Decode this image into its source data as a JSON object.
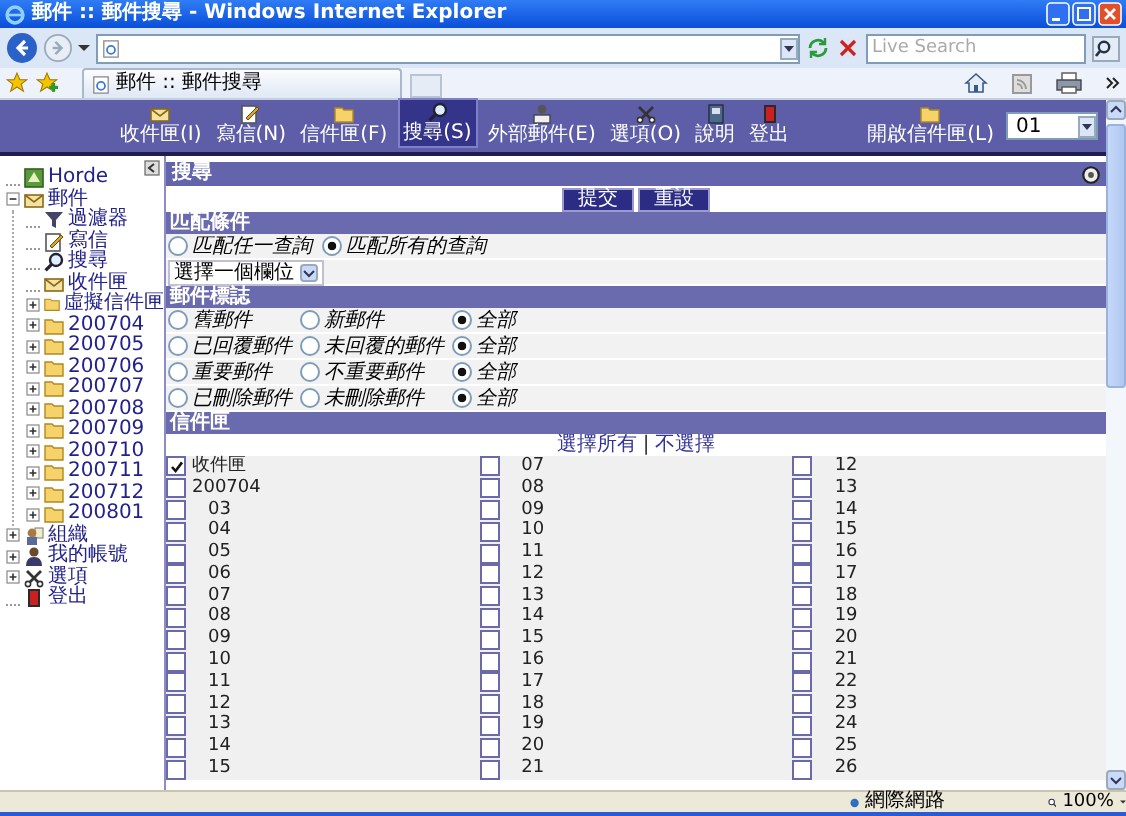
{
  "window": {
    "title": "郵件 :: 郵件搜尋 - Windows Internet Explorer"
  },
  "search": {
    "placeholder": "Live Search"
  },
  "tabs": [
    {
      "label": "郵件 :: 郵件搜尋",
      "selected": true
    }
  ],
  "nav": {
    "items": [
      {
        "label": "收件匣(I)",
        "kind": "inbox",
        "selected": false
      },
      {
        "label": "寫信(N)",
        "kind": "compose",
        "selected": false
      },
      {
        "label": "信件匣(F)",
        "kind": "folder",
        "selected": false
      },
      {
        "label": "搜尋(S)",
        "kind": "search",
        "selected": true
      },
      {
        "label": "外部郵件(E)",
        "kind": "external",
        "selected": false
      },
      {
        "label": "選項(O)",
        "kind": "options",
        "selected": false
      },
      {
        "label": "說明",
        "kind": "help",
        "selected": false
      },
      {
        "label": "登出",
        "kind": "logout",
        "selected": false
      }
    ],
    "open_folder": {
      "label": "開啟信件匣(L)",
      "value": "01"
    }
  },
  "sidebar": {
    "items": [
      {
        "label": "Horde",
        "kind": "app"
      },
      {
        "label": "郵件",
        "kind": "mail",
        "expanded": true,
        "children": [
          {
            "label": "過濾器",
            "kind": "filter"
          },
          {
            "label": "寫信",
            "kind": "compose"
          },
          {
            "label": "搜尋",
            "kind": "search"
          },
          {
            "label": "收件匣",
            "kind": "inbox"
          },
          {
            "label": "虛擬信件匣",
            "kind": "folder",
            "expanded": false
          },
          {
            "label": "200704",
            "kind": "folder",
            "expanded": false
          },
          {
            "label": "200705",
            "kind": "folder",
            "expanded": false
          },
          {
            "label": "200706",
            "kind": "folder",
            "expanded": false
          },
          {
            "label": "200707",
            "kind": "folder",
            "expanded": false
          },
          {
            "label": "200708",
            "kind": "folder",
            "expanded": false
          },
          {
            "label": "200709",
            "kind": "folder",
            "expanded": false
          },
          {
            "label": "200710",
            "kind": "folder",
            "expanded": false
          },
          {
            "label": "200711",
            "kind": "folder",
            "expanded": false
          },
          {
            "label": "200712",
            "kind": "folder",
            "expanded": false
          },
          {
            "label": "200801",
            "kind": "folder",
            "expanded": false
          }
        ]
      },
      {
        "label": "組織",
        "kind": "organizer",
        "expanded": false
      },
      {
        "label": "我的帳號",
        "kind": "account",
        "expanded": false
      },
      {
        "label": "選項",
        "kind": "options",
        "expanded": false
      },
      {
        "label": "登出",
        "kind": "logout"
      }
    ]
  },
  "panel": {
    "title": "搜尋",
    "buttons": [
      "提交",
      "重設"
    ]
  },
  "match": {
    "title": "匹配條件",
    "options": [
      {
        "label": "匹配任一查詢",
        "selected": false
      },
      {
        "label": "匹配所有的查詢",
        "selected": true
      }
    ],
    "field_select": "選擇一個欄位"
  },
  "flags": {
    "title": "郵件標誌",
    "rows": [
      {
        "options": [
          {
            "label": "舊郵件",
            "selected": false
          },
          {
            "label": "新郵件",
            "selected": false
          },
          {
            "label": "全部",
            "selected": true
          }
        ]
      },
      {
        "options": [
          {
            "label": "已回覆郵件",
            "selected": false
          },
          {
            "label": "未回覆的郵件",
            "selected": false
          },
          {
            "label": "全部",
            "selected": true
          }
        ]
      },
      {
        "options": [
          {
            "label": "重要郵件",
            "selected": false
          },
          {
            "label": "不重要郵件",
            "selected": false
          },
          {
            "label": "全部",
            "selected": true
          }
        ]
      },
      {
        "options": [
          {
            "label": "已刪除郵件",
            "selected": false
          },
          {
            "label": "未刪除郵件",
            "selected": false
          },
          {
            "label": "全部",
            "selected": true
          }
        ]
      }
    ]
  },
  "folders": {
    "title": "信件匣",
    "select_all": "選擇所有",
    "separator": "|",
    "select_none": "不選擇",
    "columns": [
      [
        {
          "label": "收件匣",
          "checked": true
        },
        {
          "label": "200704",
          "checked": false,
          "children": [
            {
              "label": "03",
              "checked": false
            },
            {
              "label": "04",
              "checked": false
            },
            {
              "label": "05",
              "checked": false
            },
            {
              "label": "06",
              "checked": false
            },
            {
              "label": "07",
              "checked": false
            },
            {
              "label": "08",
              "checked": false
            },
            {
              "label": "09",
              "checked": false
            },
            {
              "label": "10",
              "checked": false
            },
            {
              "label": "11",
              "checked": false
            },
            {
              "label": "12",
              "checked": false
            },
            {
              "label": "13",
              "checked": false
            },
            {
              "label": "14",
              "checked": false
            },
            {
              "label": "15",
              "checked": false
            }
          ]
        }
      ],
      [
        {
          "label": "07",
          "checked": false
        },
        {
          "label": "08",
          "checked": false
        },
        {
          "label": "09",
          "checked": false
        },
        {
          "label": "10",
          "checked": false
        },
        {
          "label": "11",
          "checked": false
        },
        {
          "label": "12",
          "checked": false
        },
        {
          "label": "13",
          "checked": false
        },
        {
          "label": "14",
          "checked": false
        },
        {
          "label": "15",
          "checked": false
        },
        {
          "label": "16",
          "checked": false
        },
        {
          "label": "17",
          "checked": false
        },
        {
          "label": "18",
          "checked": false
        },
        {
          "label": "19",
          "checked": false
        },
        {
          "label": "20",
          "checked": false
        },
        {
          "label": "21",
          "checked": false
        }
      ],
      [
        {
          "label": "12",
          "checked": false
        },
        {
          "label": "13",
          "checked": false
        },
        {
          "label": "14",
          "checked": false
        },
        {
          "label": "15",
          "checked": false
        },
        {
          "label": "16",
          "checked": false
        },
        {
          "label": "17",
          "checked": false
        },
        {
          "label": "18",
          "checked": false
        },
        {
          "label": "19",
          "checked": false
        },
        {
          "label": "20",
          "checked": false
        },
        {
          "label": "21",
          "checked": false
        },
        {
          "label": "22",
          "checked": false
        },
        {
          "label": "23",
          "checked": false
        },
        {
          "label": "24",
          "checked": false
        },
        {
          "label": "25",
          "checked": false
        },
        {
          "label": "26",
          "checked": false
        }
      ]
    ]
  },
  "status_bar": {
    "zone": "網際網路",
    "zoom": "100%"
  }
}
